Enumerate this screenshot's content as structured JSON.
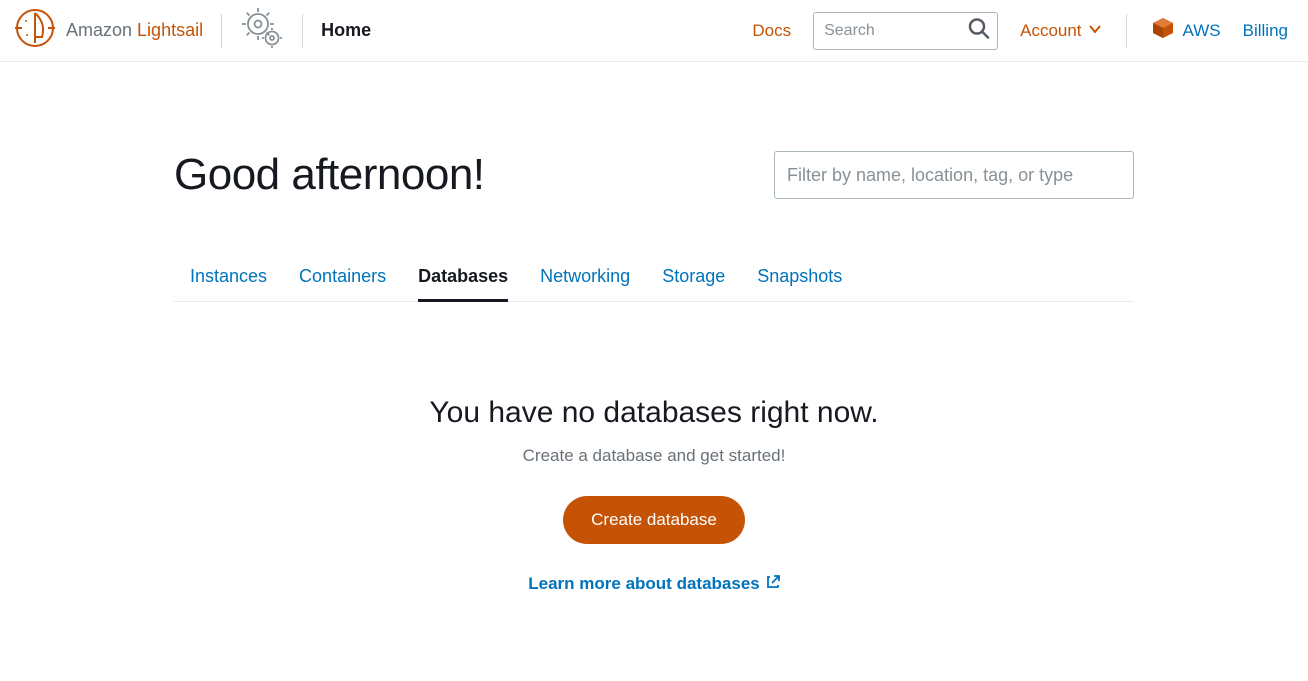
{
  "header": {
    "brand_prefix": "Amazon ",
    "brand_highlight": "Lightsail",
    "nav_home": "Home",
    "docs": "Docs",
    "search_placeholder": "Search",
    "account": "Account",
    "aws": "AWS",
    "billing": "Billing"
  },
  "main": {
    "greeting": "Good afternoon!",
    "filter_placeholder": "Filter by name, location, tag, or type",
    "tabs": {
      "instances": "Instances",
      "containers": "Containers",
      "databases": "Databases",
      "networking": "Networking",
      "storage": "Storage",
      "snapshots": "Snapshots"
    },
    "empty": {
      "title": "You have no databases right now.",
      "subtitle": "Create a database and get started!",
      "button": "Create database",
      "learn_more": "Learn more about databases"
    }
  }
}
